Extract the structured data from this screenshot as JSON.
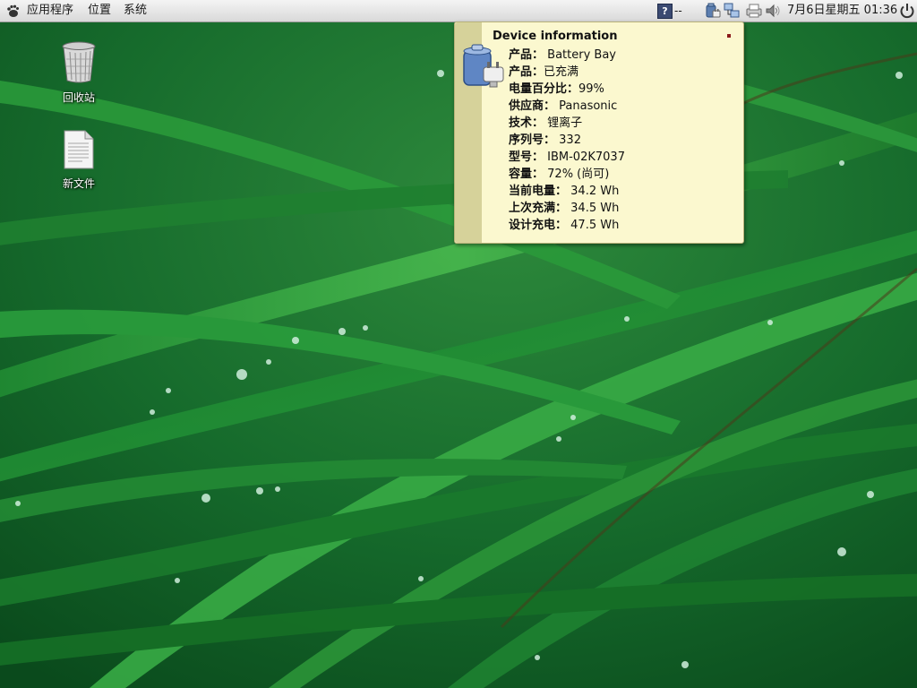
{
  "panel": {
    "menus": {
      "applications": "应用程序",
      "places": "位置",
      "system": "系统"
    },
    "help_icon": "help-icon",
    "help_text": "--",
    "tray_icons": [
      "battery-icon",
      "network-icon",
      "printer-icon",
      "volume-icon"
    ],
    "clock": "7月6日星期五 01:36",
    "power_icon": "power-icon"
  },
  "desktop": {
    "icons": [
      {
        "name": "trash-icon",
        "label": "回收站"
      },
      {
        "name": "document-icon",
        "label": "新文件"
      }
    ]
  },
  "tooltip": {
    "title": "Device information",
    "icon": "battery-device-icon",
    "rows": [
      {
        "key": "产品：",
        "value": " Battery Bay"
      },
      {
        "key": "产品：",
        "value": "已充满"
      },
      {
        "key": "电量百分比：",
        "value": "99%"
      },
      {
        "key": "供应商：",
        "value": " Panasonic"
      },
      {
        "key": "技术：",
        "value": " 锂离子"
      },
      {
        "key": "序列号：",
        "value": " 332"
      },
      {
        "key": "型号：",
        "value": " IBM-02K7037"
      },
      {
        "key": "容量：",
        "value": " 72% (尚可)"
      },
      {
        "key": "当前电量：",
        "value": " 34.2 Wh"
      },
      {
        "key": "上次充满：",
        "value": " 34.5 Wh"
      },
      {
        "key": "设计充电：",
        "value": " 47.5 Wh"
      }
    ]
  },
  "colors": {
    "panel_bg": "#e4e4e4",
    "tooltip_bg": "#fbf8cf",
    "tooltip_sidebar": "#d6d29a",
    "wallpaper_base": "#0f5a24"
  }
}
